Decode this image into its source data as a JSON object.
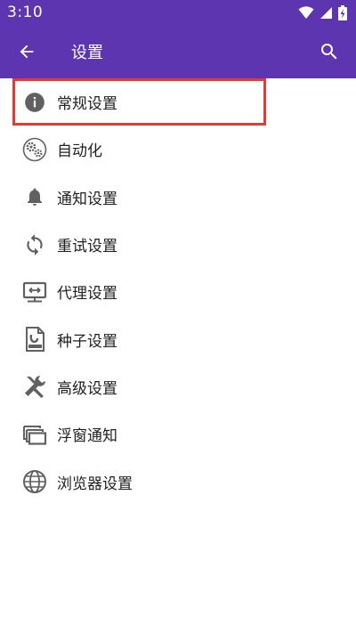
{
  "status_bar": {
    "time": "3:10"
  },
  "toolbar": {
    "title": "设置",
    "back_icon": "arrow-back-icon",
    "search_icon": "search-icon"
  },
  "menu": {
    "items": [
      {
        "label": "常规设置",
        "icon": "info-icon"
      },
      {
        "label": "自动化",
        "icon": "automation-gears-icon"
      },
      {
        "label": "通知设置",
        "icon": "bell-icon"
      },
      {
        "label": "重试设置",
        "icon": "retry-icon"
      },
      {
        "label": "代理设置",
        "icon": "proxy-monitor-icon"
      },
      {
        "label": "种子设置",
        "icon": "torrent-file-icon"
      },
      {
        "label": "高级设置",
        "icon": "wrench-screwdriver-icon"
      },
      {
        "label": "浮窗通知",
        "icon": "floating-window-icon"
      },
      {
        "label": "浏览器设置",
        "icon": "globe-icon"
      }
    ]
  },
  "colors": {
    "appbar": "#5e35b1",
    "icon": "#616161",
    "highlight": "#e53935"
  }
}
